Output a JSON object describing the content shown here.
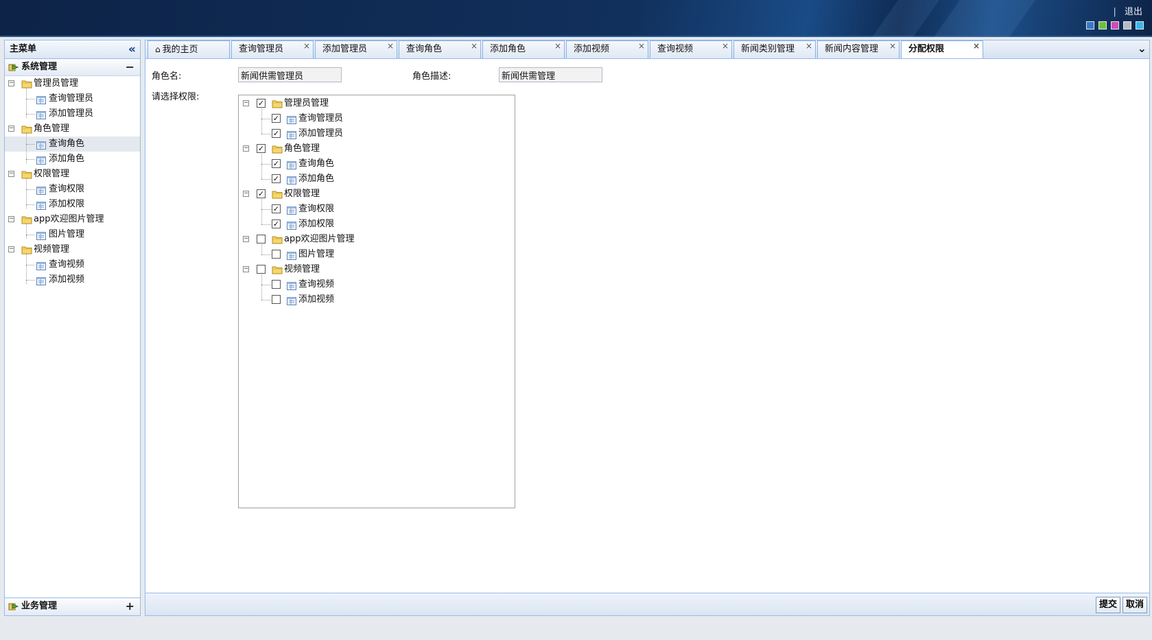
{
  "header": {
    "logout_label": "退出",
    "separator": "|",
    "theme_colors": [
      "#3a78c4",
      "#6cc03a",
      "#d14bb8",
      "#b8bcc2",
      "#3ab6e8"
    ]
  },
  "sidebar": {
    "title": "主菜单",
    "collapse_symbol": "«",
    "section_system": {
      "label": "系统管理",
      "toggle": "−"
    },
    "section_business": {
      "label": "业务管理",
      "toggle": "+"
    },
    "tree": [
      {
        "label": "管理员管理",
        "children": [
          "查询管理员",
          "添加管理员"
        ]
      },
      {
        "label": "角色管理",
        "children": [
          "查询角色",
          "添加角色"
        ]
      },
      {
        "label": "权限管理",
        "children": [
          "查询权限",
          "添加权限"
        ]
      },
      {
        "label": "app欢迎图片管理",
        "children": [
          "图片管理"
        ]
      },
      {
        "label": "视频管理",
        "children": [
          "查询视频",
          "添加视频"
        ]
      }
    ],
    "selected_item": "查询角色"
  },
  "tabs": {
    "items": [
      "我的主页",
      "查询管理员",
      "添加管理员",
      "查询角色",
      "添加角色",
      "添加视频",
      "查询视频",
      "新闻类别管理",
      "新闻内容管理",
      "分配权限"
    ],
    "active": "分配权限",
    "close_symbol": "×",
    "scroll_symbol": "»"
  },
  "form": {
    "role_name_label": "角色名:",
    "role_name_value": "新闻供需管理员",
    "role_desc_label": "角色描述:",
    "role_desc_value": "新闻供需管理",
    "perm_label": "请选择权限:",
    "check_mark": "✓",
    "permissions": [
      {
        "label": "管理员管理",
        "checked": true,
        "children": [
          {
            "label": "查询管理员",
            "checked": true
          },
          {
            "label": "添加管理员",
            "checked": true
          }
        ]
      },
      {
        "label": "角色管理",
        "checked": true,
        "children": [
          {
            "label": "查询角色",
            "checked": true
          },
          {
            "label": "添加角色",
            "checked": true
          }
        ]
      },
      {
        "label": "权限管理",
        "checked": true,
        "children": [
          {
            "label": "查询权限",
            "checked": true
          },
          {
            "label": "添加权限",
            "checked": true
          }
        ]
      },
      {
        "label": "app欢迎图片管理",
        "checked": false,
        "children": [
          {
            "label": "图片管理",
            "checked": false
          }
        ]
      },
      {
        "label": "视频管理",
        "checked": false,
        "children": [
          {
            "label": "查询视频",
            "checked": false
          },
          {
            "label": "添加视频",
            "checked": false
          }
        ]
      }
    ]
  },
  "footer": {
    "submit_label": "提交",
    "cancel_label": "取消"
  }
}
